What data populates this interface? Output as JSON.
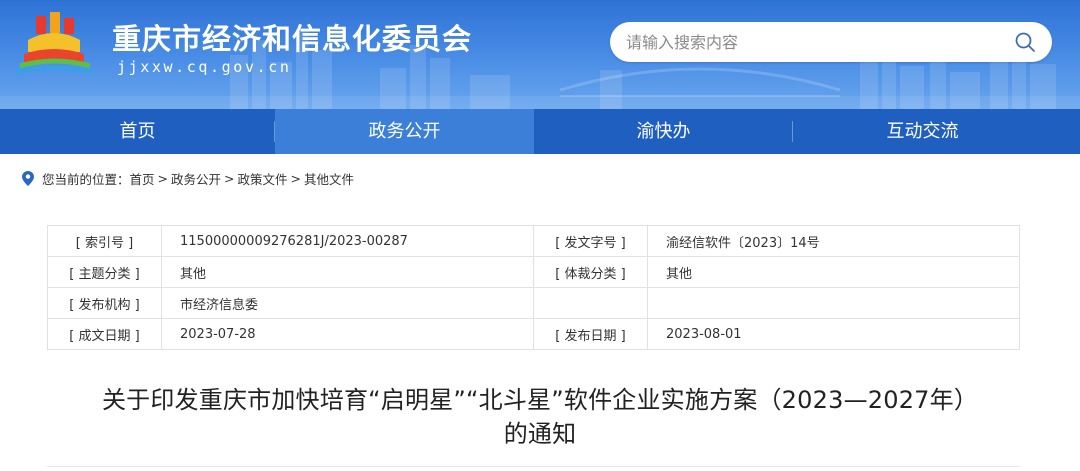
{
  "header": {
    "site_title": "重庆市经济和信息化委员会",
    "site_domain": "jjxxw.cq.gov.cn",
    "search_placeholder": "请输入搜索内容"
  },
  "nav": {
    "items": [
      {
        "label": "首页"
      },
      {
        "label": "政务公开"
      },
      {
        "label": "渝快办"
      },
      {
        "label": "互动交流"
      }
    ],
    "active_index": 1
  },
  "breadcrumb": {
    "prefix": "您当前的位置：",
    "items": [
      "首页",
      "政务公开",
      "政策文件",
      "其他文件"
    ],
    "separator": ">"
  },
  "info": {
    "rows": [
      {
        "label1": "[ 索引号 ]",
        "value1": "11500000009276281J/2023-00287",
        "label2": "[ 发文字号 ]",
        "value2": "渝经信软件〔2023〕14号"
      },
      {
        "label1": "[ 主题分类 ]",
        "value1": "其他",
        "label2": "[ 体裁分类 ]",
        "value2": "其他"
      },
      {
        "label1": "[ 发布机构 ]",
        "value1": "市经济信息委",
        "label2": "",
        "value2": ""
      },
      {
        "label1": "[ 成文日期 ]",
        "value1": "2023-07-28",
        "label2": "[ 发布日期 ]",
        "value2": "2023-08-01"
      }
    ]
  },
  "document": {
    "title_line1": "关于印发重庆市加快培育“启明星”“北斗星”软件企业实施方案（2023—2027年）",
    "title_line2": "的通知"
  },
  "colors": {
    "header_blue": "#2f72d6",
    "nav_blue": "#1f5fbf",
    "nav_active": "#3b7fd9"
  }
}
